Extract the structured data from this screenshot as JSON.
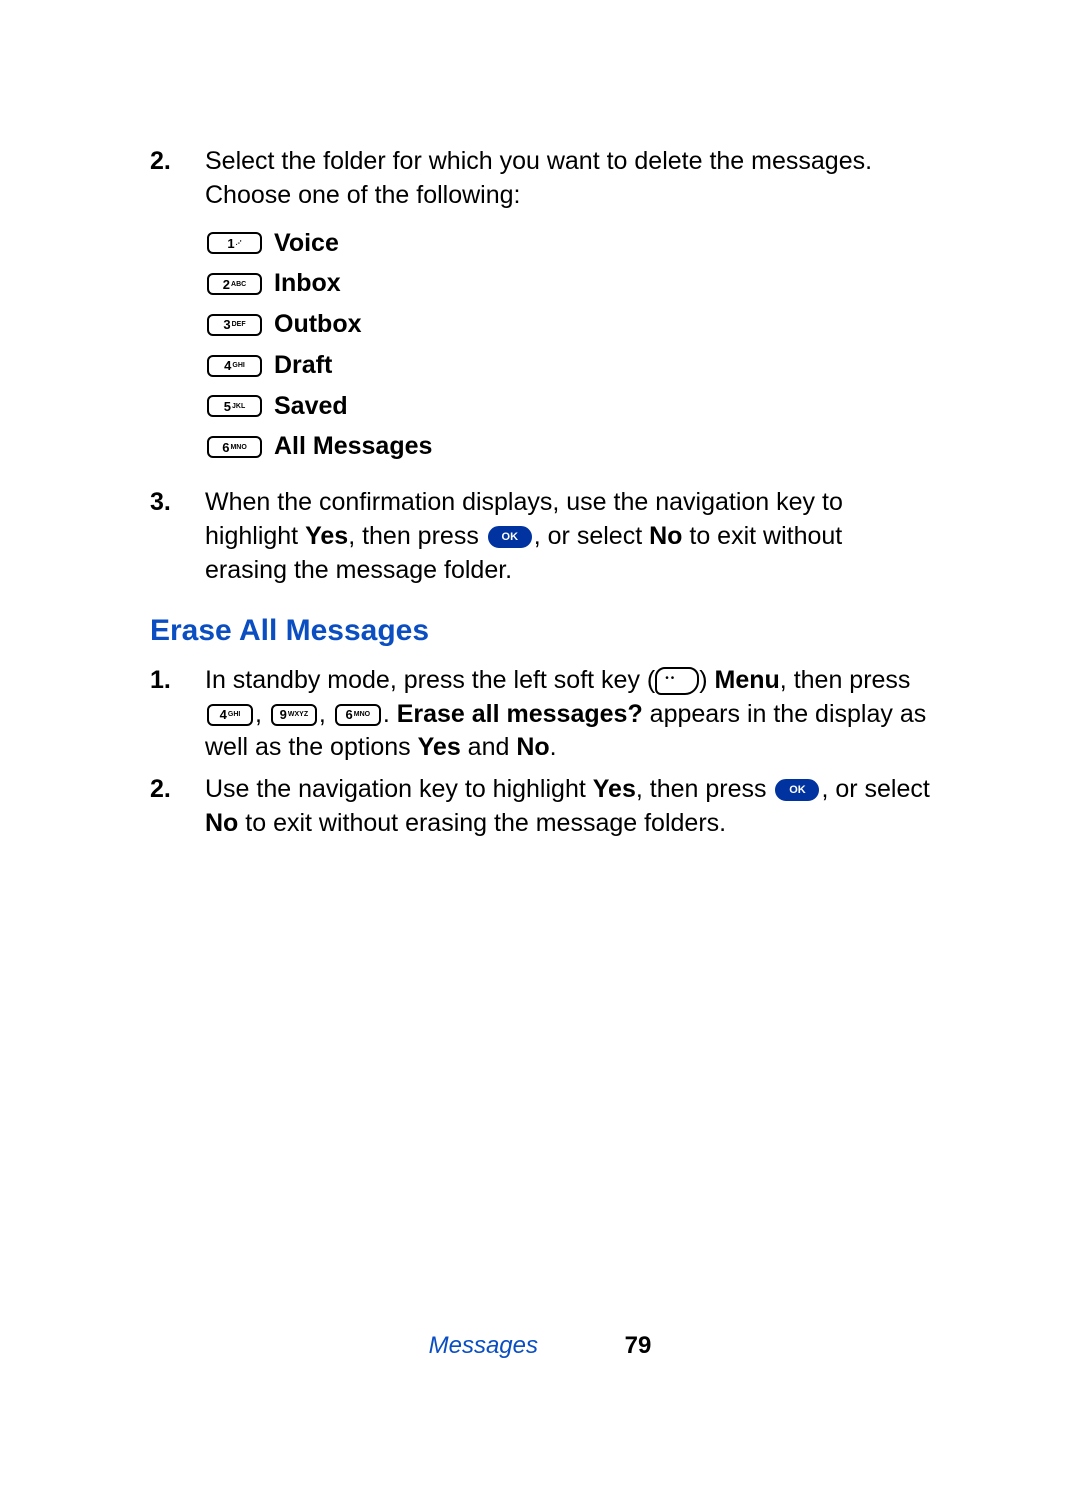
{
  "step2": {
    "marker": "2.",
    "text": "Select the folder for which you want to delete the messages. Choose one of the following:"
  },
  "keypad_options": [
    {
      "keyNum": "1",
      "keySub": ".-'",
      "label": "Voice"
    },
    {
      "keyNum": "2",
      "keySub": "ABC",
      "label": "Inbox"
    },
    {
      "keyNum": "3",
      "keySub": "DEF",
      "label": "Outbox"
    },
    {
      "keyNum": "4",
      "keySub": "GHI",
      "label": "Draft"
    },
    {
      "keyNum": "5",
      "keySub": "JKL",
      "label": "Saved"
    },
    {
      "keyNum": "6",
      "keySub": "MNO",
      "label": "All Messages"
    }
  ],
  "step3": {
    "marker": "3.",
    "part1": "When the confirmation displays, use the navigation key to highlight ",
    "yes": "Yes",
    "part2": ", then press ",
    "ok": "OK",
    "part3": ", or select ",
    "no": "No",
    "part4": " to exit without erasing the message folder."
  },
  "heading": "Erase All Messages",
  "sec2_step1": {
    "marker": "1.",
    "part1": "In standby mode, press the left soft key (",
    "part2": ") ",
    "menu": "Menu",
    "part3": ", then press ",
    "key4": {
      "num": "4",
      "sub": "GHI"
    },
    "key9": {
      "num": "9",
      "sub": "WXYZ"
    },
    "key6": {
      "num": "6",
      "sub": "MNO"
    },
    "part4": ". ",
    "erase_q": "Erase all messages?",
    "part5": " appears in the display as well as the options ",
    "yes": "Yes",
    "part6": " and ",
    "no": "No",
    "part7": "."
  },
  "sec2_step2": {
    "marker": "2.",
    "part1": "Use the navigation key to highlight ",
    "yes": "Yes",
    "part2": ", then press ",
    "ok": "OK",
    "part3": ", or select ",
    "no": "No",
    "part4": " to exit without erasing the message folders."
  },
  "footer": {
    "section": "Messages",
    "page": "79"
  }
}
